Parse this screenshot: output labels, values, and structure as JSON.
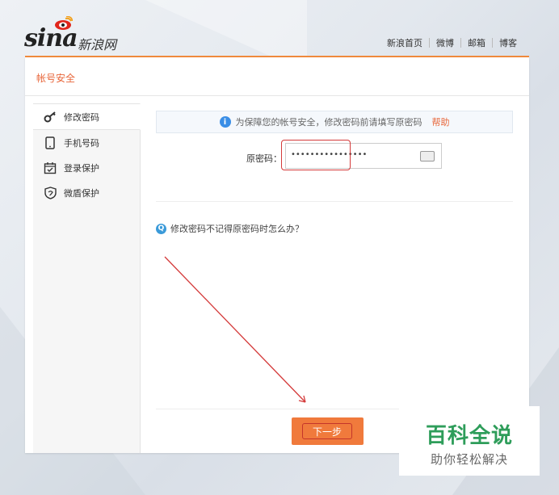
{
  "logo": {
    "latin": "sina",
    "chinese": "新浪网"
  },
  "topnav": {
    "links": [
      "新浪首页",
      "微博",
      "邮箱",
      "博客"
    ]
  },
  "panel": {
    "title": "帐号安全"
  },
  "sidebar": {
    "items": [
      {
        "label": "修改密码",
        "icon": "key-icon",
        "active": true
      },
      {
        "label": "手机号码",
        "icon": "phone-icon",
        "active": false
      },
      {
        "label": "登录保护",
        "icon": "login-protect-icon",
        "active": false
      },
      {
        "label": "微盾保护",
        "icon": "shield-icon",
        "active": false
      }
    ]
  },
  "notice": {
    "text": "为保障您的帐号安全，修改密码前请填写原密码",
    "help": "帮助"
  },
  "form": {
    "label": "原密码：",
    "value": "••••••••••••••••"
  },
  "forgot": {
    "text": "修改密码不记得原密码时怎么办？"
  },
  "next_button": {
    "label": "下一步"
  },
  "watermark": {
    "big": "百科全说",
    "small": "助你轻松解决"
  },
  "colors": {
    "accent": "#f08a3c",
    "annotation": "#d43a3a",
    "watermark": "#2e9d5a"
  }
}
